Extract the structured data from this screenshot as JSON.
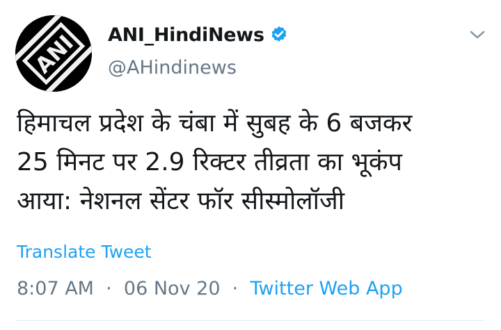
{
  "user": {
    "display_name": "ANI_HindiNews",
    "handle": "@AHindinews",
    "avatar_logo_text": "ANI",
    "verified": true,
    "verified_color": "#1da1f2"
  },
  "tweet": {
    "lines": [
      "हिमाचल प्रदेश के चंबा में सुबह के 6 बजकर",
      "25 मिनट पर 2.9 रिक्टर तीव्रता का भूकंप",
      "आया: नेशनल सेंटर फॉर सीस्मोलॉजी"
    ],
    "translate_label": "Translate Tweet",
    "time": "8:07 AM",
    "separator": "·",
    "date": "06 Nov 20",
    "source": "Twitter Web App"
  },
  "icons": {
    "verified": "verified-badge-icon",
    "menu": "chevron-down-icon"
  },
  "colors": {
    "link": "#1da1f2",
    "text": "#14171a",
    "secondary": "#657786"
  }
}
